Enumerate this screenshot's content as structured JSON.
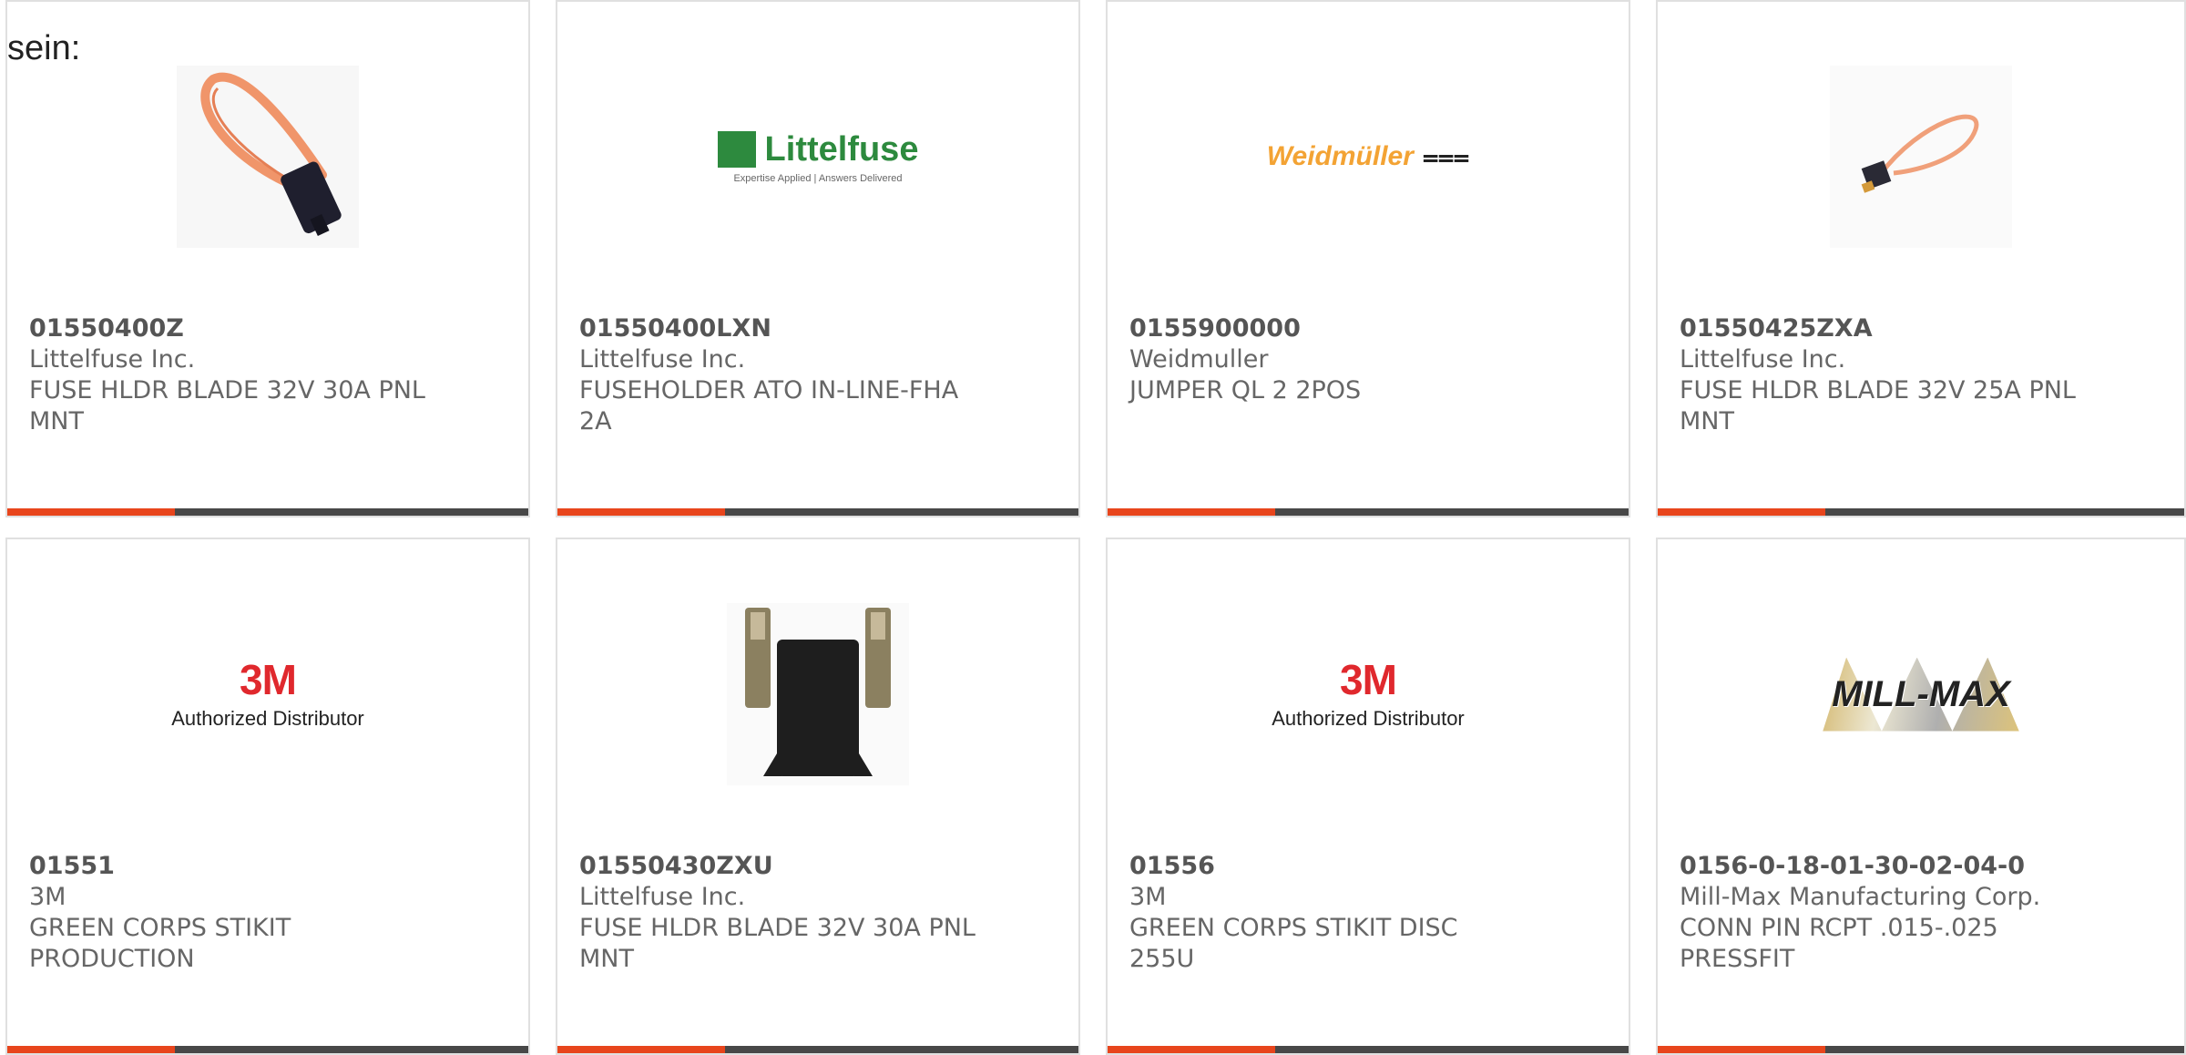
{
  "lead_text": "sein:",
  "colors": {
    "accent": "#e8451c",
    "bar": "#484848",
    "border": "#e0e0e0"
  },
  "cards": [
    {
      "part_number": "01550400Z",
      "manufacturer": "Littelfuse Inc.",
      "description": "FUSE HLDR BLADE 32V 30A PNL MNT",
      "image": "fuse-loop-orange-photo"
    },
    {
      "part_number": "01550400LXN",
      "manufacturer": "Littelfuse Inc.",
      "description": "FUSEHOLDER ATO IN-LINE-FHA 2A",
      "image": "littelfuse-logo",
      "logo": {
        "word": "Littelfuse",
        "tagline": "Expertise Applied | Answers Delivered"
      }
    },
    {
      "part_number": "0155900000",
      "manufacturer": "Weidmuller",
      "description": "JUMPER QL 2 2POS",
      "image": "weidmuller-logo",
      "logo": {
        "word": "Weidmüller",
        "symbol": "⩶"
      }
    },
    {
      "part_number": "01550425ZXA",
      "manufacturer": "Littelfuse Inc.",
      "description": "FUSE HLDR BLADE 32V 25A PNL MNT",
      "image": "fuse-loop-small-photo"
    },
    {
      "part_number": "01551",
      "manufacturer": "3M",
      "description": "GREEN CORPS STIKIT PRODUCTION",
      "image": "3m-logo",
      "logo": {
        "word": "3M",
        "sub": "Authorized Distributor"
      }
    },
    {
      "part_number": "01550430ZXU",
      "manufacturer": "Littelfuse Inc.",
      "description": "FUSE HLDR BLADE 32V 30A PNL MNT",
      "image": "fuse-housing-terminals-photo"
    },
    {
      "part_number": "01556",
      "manufacturer": "3M",
      "description": "GREEN CORPS STIKIT DISC 255U",
      "image": "3m-logo",
      "logo": {
        "word": "3M",
        "sub": "Authorized Distributor"
      }
    },
    {
      "part_number": "0156-0-18-01-30-02-04-0",
      "manufacturer": "Mill-Max Manufacturing Corp.",
      "description": "CONN PIN RCPT .015-.025 PRESSFIT",
      "image": "mill-max-logo",
      "logo": {
        "word": "MILL-MAX"
      }
    }
  ]
}
